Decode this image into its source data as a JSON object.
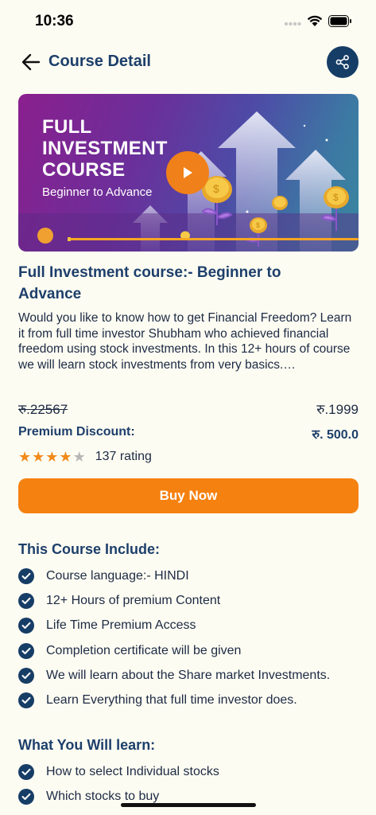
{
  "status_bar": {
    "time": "10:36"
  },
  "header": {
    "title": "Course Detail"
  },
  "banner": {
    "title": "FULL\nINVESTMENT\nCOURSE",
    "subtitle": "Beginner to Advance",
    "progress": 0.01
  },
  "course": {
    "title": "Full Investment course:- Beginner to Advance",
    "description": "Would you like to know how to get Financial Freedom? Learn it from full time investor Shubham who achieved financial freedom using stock investments. In this 12+ hours of course we will learn stock investments from very basics.…",
    "original_price": "रु.22567",
    "current_price": "रु.1999",
    "discount_label": "Premium Discount:",
    "discount_value": "रु. 500.0",
    "rating": 4,
    "rating_max": 5,
    "rating_text": "137 rating",
    "buy_label": "Buy Now"
  },
  "includes": {
    "title": "This Course Include:",
    "items": [
      "Course language:- HINDI",
      "12+ Hours of premium Content",
      "Life Time Premium Access",
      "Completion certificate will be given",
      "We will learn about the Share market Investments.",
      "Learn Everything that full time investor does."
    ]
  },
  "learn": {
    "title": "What You Will learn:",
    "items": [
      "How to select Individual stocks",
      "Which stocks to buy"
    ]
  },
  "colors": {
    "background": "#fdfcf2",
    "primary": "#163d66",
    "accent": "#f58110",
    "star": "#f18a1a"
  },
  "icons": [
    "signal-icon",
    "wifi-icon",
    "battery-icon",
    "back-arrow-icon",
    "share-icon",
    "play-icon",
    "check-icon",
    "star-icon"
  ]
}
